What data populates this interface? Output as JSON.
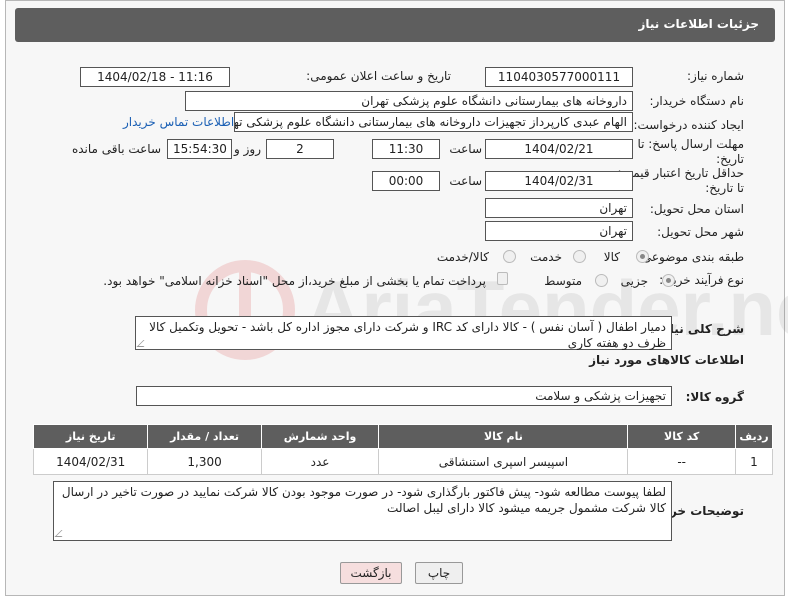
{
  "header": {
    "title": "جزئیات اطلاعات نیاز"
  },
  "fields": {
    "need_number_label": "شماره نیاز:",
    "need_number": "1104030577000111",
    "announce_label": "تاریخ و ساعت اعلان عمومی:",
    "announce_value": "1404/02/18 - 11:16",
    "buyer_org_label": "نام دستگاه خریدار:",
    "buyer_org": "داروخانه های بیمارستانی دانشگاه علوم پزشکی تهران",
    "creator_label": "ایجاد کننده درخواست:",
    "creator": "الهام عبدی کارپرداز تجهیزات داروخانه های بیمارستانی دانشگاه علوم پزشکی تهران",
    "contact_link": "اطلاعات تماس خریدار",
    "reply_deadline_label": "مهلت ارسال پاسخ: تا تاریخ:",
    "reply_date": "1404/02/21",
    "time_label": "ساعت",
    "reply_time": "11:30",
    "days_value": "2",
    "days_label": "روز و",
    "remaining_time": "15:54:30",
    "remaining_label": "ساعت باقی مانده",
    "price_validity_label": "حداقل تاریخ اعتبار قیمت: تا تاریخ:",
    "price_date": "1404/02/31",
    "time_label2": "ساعت",
    "price_time": "00:00",
    "province_label": "استان محل تحویل:",
    "province": "تهران",
    "city_label": "شهر محل تحویل:",
    "city": "تهران",
    "category_label": "طبقه بندی موضوعی:",
    "category_options": [
      "کالا",
      "خدمت",
      "کالا/خدمت"
    ],
    "purchase_type_label": "نوع فرآیند خرید :",
    "purchase_options": [
      "جزیی",
      "متوسط"
    ],
    "payment_note": "پرداخت تمام یا بخشی از مبلغ خرید،از محل \"اسناد خزانه اسلامی\" خواهد بود.",
    "description_label": "شرح کلی نیاز:",
    "description": "دمیار اطفال ( آسان نفس ) - کالا دارای کد IRC و شرکت دارای مجوز اداره کل باشد - تحویل وتکمیل کالا ظرف دو هفته کاری",
    "goods_info_title": "اطلاعات کالاهای مورد نیاز",
    "goods_group_label": "گروه کالا:",
    "goods_group": "تجهیزات پزشکی و سلامت",
    "buyer_notes_label": "توضیحات خریدار:",
    "buyer_notes": "لطفا پیوست مطالعه شود- پیش فاکتور بارگذاری شود- در صورت موجود بودن کالا شرکت نمایید در صورت تاخیر در ارسال کالا شرکت مشمول جریمه میشود کالا دارای لیبل اصالت"
  },
  "table": {
    "headers": [
      "ردیف",
      "کد کالا",
      "نام کالا",
      "واحد شمارش",
      "تعداد / مقدار",
      "تاریخ نیاز"
    ],
    "rows": [
      [
        "1",
        "--",
        "اسپیسر اسپری استنشاقی",
        "عدد",
        "1,300",
        "1404/02/31"
      ]
    ]
  },
  "buttons": {
    "print": "چاپ",
    "back": "بازگشت"
  },
  "watermark": "AriaTender.neT",
  "colors": {
    "header_bg": "#5e5e5e",
    "link": "#1a5fb4",
    "back_btn_bg": "#f6dede"
  }
}
